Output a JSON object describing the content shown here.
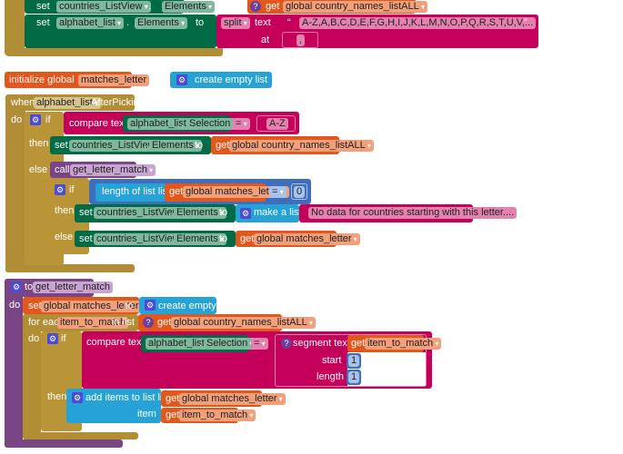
{
  "colors": {
    "control": "#b18e35",
    "component": "#006b45",
    "variable": "#e2581c",
    "text": "#c4005a",
    "list": "#27a2d7",
    "math": "#3f6ebd",
    "procedure": "#7a4585"
  },
  "block1": {
    "row1": {
      "set": "set",
      "component": "countries_ListView",
      "dot": ".",
      "property": "Elements",
      "to": "to",
      "get": "get",
      "variable": "global country_names_listALL"
    },
    "row2": {
      "set": "set",
      "component": "alphabet_list",
      "dot": ".",
      "property": "Elements",
      "to": "to",
      "split": "split",
      "text_label": "text",
      "text_value": "A-Z,A,B,C,D,E,F,G,H,I,J,K,L,M,N,O,P,Q,R,S,T,U,V,...",
      "at_label": "at",
      "at_value": ","
    }
  },
  "init": {
    "label": "initialize global",
    "name": "matches_letter",
    "to": "to",
    "value": "create empty list"
  },
  "event": {
    "when": "when",
    "component": "alphabet_list",
    "event": ".AfterPicking",
    "do": "do",
    "if": "if",
    "then": "then",
    "else": "else",
    "compare": {
      "label": "compare texts",
      "component": "alphabet_list",
      "dot": ".",
      "property": "Selection",
      "op": "=",
      "value": "A-Z"
    },
    "then_set": {
      "set": "set",
      "component": "countries_ListView",
      "dot": ".",
      "property": "Elements",
      "to": "to",
      "get": "get",
      "variable": "global country_names_listALL"
    },
    "call": {
      "label": "call",
      "name": "get_letter_match"
    },
    "inner_if": {
      "if": "if",
      "then": "then",
      "else": "else",
      "length_label": "length of list  list",
      "get": "get",
      "variable": "global matches_letter",
      "op": "=",
      "number": "0",
      "then_set": {
        "set": "set",
        "component": "countries_ListView",
        "dot": ".",
        "property": "Elements",
        "to": "to",
        "make_list": "make a list",
        "message": "No data for countries starting with this letter...."
      },
      "else_set": {
        "set": "set",
        "component": "countries_ListView",
        "dot": ".",
        "property": "Elements",
        "to": "to",
        "get": "get",
        "variable": "global matches_letter"
      }
    }
  },
  "procedure": {
    "to": "to",
    "name": "get_letter_match",
    "do": "do",
    "set": {
      "set": "set",
      "variable": "global matches_letter",
      "to": "to",
      "value": "create empty list"
    },
    "foreach": {
      "label": "for each",
      "item": "item_to_match",
      "in_list": "in list",
      "get": "get",
      "variable": "global country_names_listALL",
      "do": "do"
    },
    "if": {
      "if": "if",
      "then": "then",
      "compare_label": "compare texts",
      "component": "alphabet_list",
      "dot": ".",
      "property": "Selection",
      "op": "=",
      "segment_label": "segment  text",
      "get": "get",
      "segment_var": "item_to_match",
      "start_label": "start",
      "start": "1",
      "length_label": "length",
      "length": "1"
    },
    "add": {
      "label": "add items to list   list",
      "get": "get",
      "list_var": "global matches_letter",
      "item_label": "item",
      "item_var": "item_to_match"
    }
  }
}
